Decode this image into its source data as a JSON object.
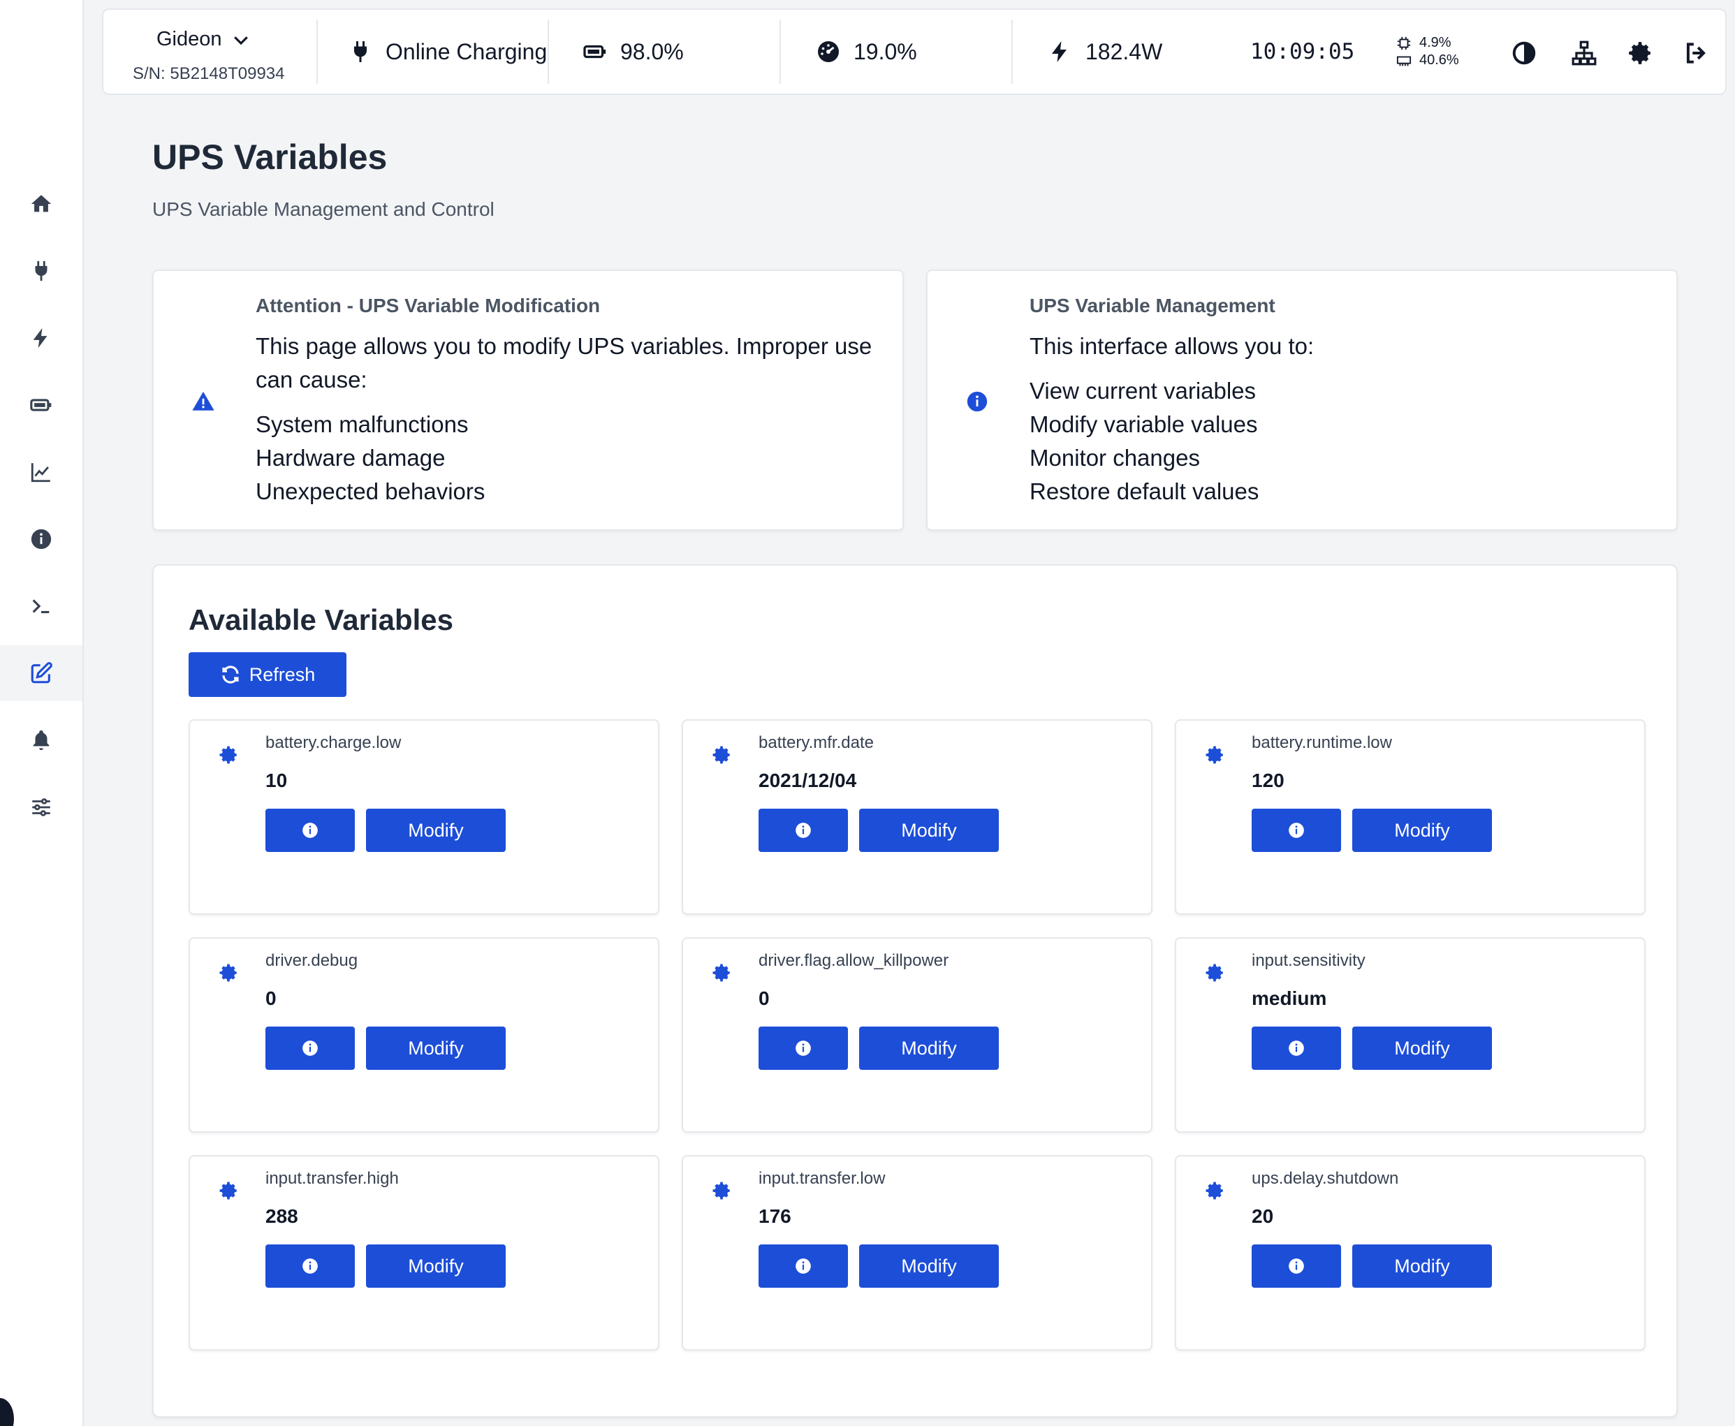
{
  "header": {
    "device_name": "Gideon",
    "serial": "S/N: 5B2148T09934",
    "status": "Online Charging",
    "battery": "98.0%",
    "load": "19.0%",
    "power": "182.4W",
    "time": "10:09:05",
    "cpu": "4.9%",
    "memory": "40.6%",
    "icons": [
      "plug-icon",
      "battery-icon",
      "gauge-icon",
      "bolt-icon",
      "cpu-icon",
      "memory-icon",
      "theme-toggle-icon",
      "network-icon",
      "gear-icon",
      "logout-icon"
    ]
  },
  "sidebar": {
    "items": [
      "home-icon",
      "plug-icon",
      "bolt-icon",
      "battery-icon",
      "chart-line-icon",
      "info-icon",
      "terminal-icon",
      "edit-icon",
      "bell-icon",
      "sliders-icon"
    ],
    "active_index": 7
  },
  "page": {
    "title": "UPS Variables",
    "subtitle": "UPS Variable Management and Control"
  },
  "warning_box": {
    "title": "Attention - UPS Variable Modification",
    "text": "This page allows you to modify UPS variables. Improper use can cause:",
    "items": [
      "System malfunctions",
      "Hardware damage",
      "Unexpected behaviors"
    ]
  },
  "info_box": {
    "title": "UPS Variable Management",
    "text": "This interface allows you to:",
    "items": [
      "View current variables",
      "Modify variable values",
      "Monitor changes",
      "Restore default values"
    ]
  },
  "variables": {
    "title": "Available Variables",
    "refresh_label": "Refresh",
    "modify_label": "Modify",
    "items": [
      {
        "name": "battery.charge.low",
        "value": "10"
      },
      {
        "name": "battery.mfr.date",
        "value": "2021/12/04"
      },
      {
        "name": "battery.runtime.low",
        "value": "120"
      },
      {
        "name": "driver.debug",
        "value": "0"
      },
      {
        "name": "driver.flag.allow_killpower",
        "value": "0"
      },
      {
        "name": "input.sensitivity",
        "value": "medium"
      },
      {
        "name": "input.transfer.high",
        "value": "288"
      },
      {
        "name": "input.transfer.low",
        "value": "176"
      },
      {
        "name": "ups.delay.shutdown",
        "value": "20"
      }
    ]
  },
  "colors": {
    "accent": "#1d4ed8",
    "background": "#f3f4f6",
    "card": "#ffffff"
  }
}
